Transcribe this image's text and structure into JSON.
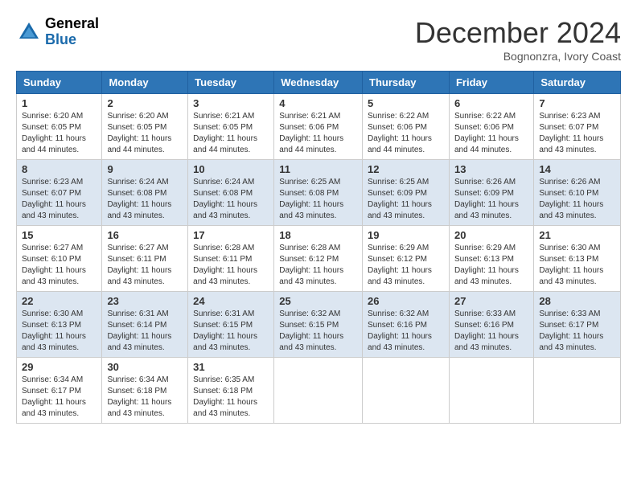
{
  "header": {
    "logo_general": "General",
    "logo_blue": "Blue",
    "month_title": "December 2024",
    "location": "Bognonzra, Ivory Coast"
  },
  "days_of_week": [
    "Sunday",
    "Monday",
    "Tuesday",
    "Wednesday",
    "Thursday",
    "Friday",
    "Saturday"
  ],
  "weeks": [
    [
      {
        "day": "1",
        "sunrise": "6:20 AM",
        "sunset": "6:05 PM",
        "daylight": "11 hours and 44 minutes."
      },
      {
        "day": "2",
        "sunrise": "6:20 AM",
        "sunset": "6:05 PM",
        "daylight": "11 hours and 44 minutes."
      },
      {
        "day": "3",
        "sunrise": "6:21 AM",
        "sunset": "6:05 PM",
        "daylight": "11 hours and 44 minutes."
      },
      {
        "day": "4",
        "sunrise": "6:21 AM",
        "sunset": "6:06 PM",
        "daylight": "11 hours and 44 minutes."
      },
      {
        "day": "5",
        "sunrise": "6:22 AM",
        "sunset": "6:06 PM",
        "daylight": "11 hours and 44 minutes."
      },
      {
        "day": "6",
        "sunrise": "6:22 AM",
        "sunset": "6:06 PM",
        "daylight": "11 hours and 44 minutes."
      },
      {
        "day": "7",
        "sunrise": "6:23 AM",
        "sunset": "6:07 PM",
        "daylight": "11 hours and 43 minutes."
      }
    ],
    [
      {
        "day": "8",
        "sunrise": "6:23 AM",
        "sunset": "6:07 PM",
        "daylight": "11 hours and 43 minutes."
      },
      {
        "day": "9",
        "sunrise": "6:24 AM",
        "sunset": "6:08 PM",
        "daylight": "11 hours and 43 minutes."
      },
      {
        "day": "10",
        "sunrise": "6:24 AM",
        "sunset": "6:08 PM",
        "daylight": "11 hours and 43 minutes."
      },
      {
        "day": "11",
        "sunrise": "6:25 AM",
        "sunset": "6:08 PM",
        "daylight": "11 hours and 43 minutes."
      },
      {
        "day": "12",
        "sunrise": "6:25 AM",
        "sunset": "6:09 PM",
        "daylight": "11 hours and 43 minutes."
      },
      {
        "day": "13",
        "sunrise": "6:26 AM",
        "sunset": "6:09 PM",
        "daylight": "11 hours and 43 minutes."
      },
      {
        "day": "14",
        "sunrise": "6:26 AM",
        "sunset": "6:10 PM",
        "daylight": "11 hours and 43 minutes."
      }
    ],
    [
      {
        "day": "15",
        "sunrise": "6:27 AM",
        "sunset": "6:10 PM",
        "daylight": "11 hours and 43 minutes."
      },
      {
        "day": "16",
        "sunrise": "6:27 AM",
        "sunset": "6:11 PM",
        "daylight": "11 hours and 43 minutes."
      },
      {
        "day": "17",
        "sunrise": "6:28 AM",
        "sunset": "6:11 PM",
        "daylight": "11 hours and 43 minutes."
      },
      {
        "day": "18",
        "sunrise": "6:28 AM",
        "sunset": "6:12 PM",
        "daylight": "11 hours and 43 minutes."
      },
      {
        "day": "19",
        "sunrise": "6:29 AM",
        "sunset": "6:12 PM",
        "daylight": "11 hours and 43 minutes."
      },
      {
        "day": "20",
        "sunrise": "6:29 AM",
        "sunset": "6:13 PM",
        "daylight": "11 hours and 43 minutes."
      },
      {
        "day": "21",
        "sunrise": "6:30 AM",
        "sunset": "6:13 PM",
        "daylight": "11 hours and 43 minutes."
      }
    ],
    [
      {
        "day": "22",
        "sunrise": "6:30 AM",
        "sunset": "6:13 PM",
        "daylight": "11 hours and 43 minutes."
      },
      {
        "day": "23",
        "sunrise": "6:31 AM",
        "sunset": "6:14 PM",
        "daylight": "11 hours and 43 minutes."
      },
      {
        "day": "24",
        "sunrise": "6:31 AM",
        "sunset": "6:15 PM",
        "daylight": "11 hours and 43 minutes."
      },
      {
        "day": "25",
        "sunrise": "6:32 AM",
        "sunset": "6:15 PM",
        "daylight": "11 hours and 43 minutes."
      },
      {
        "day": "26",
        "sunrise": "6:32 AM",
        "sunset": "6:16 PM",
        "daylight": "11 hours and 43 minutes."
      },
      {
        "day": "27",
        "sunrise": "6:33 AM",
        "sunset": "6:16 PM",
        "daylight": "11 hours and 43 minutes."
      },
      {
        "day": "28",
        "sunrise": "6:33 AM",
        "sunset": "6:17 PM",
        "daylight": "11 hours and 43 minutes."
      }
    ],
    [
      {
        "day": "29",
        "sunrise": "6:34 AM",
        "sunset": "6:17 PM",
        "daylight": "11 hours and 43 minutes."
      },
      {
        "day": "30",
        "sunrise": "6:34 AM",
        "sunset": "6:18 PM",
        "daylight": "11 hours and 43 minutes."
      },
      {
        "day": "31",
        "sunrise": "6:35 AM",
        "sunset": "6:18 PM",
        "daylight": "11 hours and 43 minutes."
      },
      null,
      null,
      null,
      null
    ]
  ],
  "labels": {
    "sunrise": "Sunrise: ",
    "sunset": "Sunset: ",
    "daylight": "Daylight: "
  }
}
